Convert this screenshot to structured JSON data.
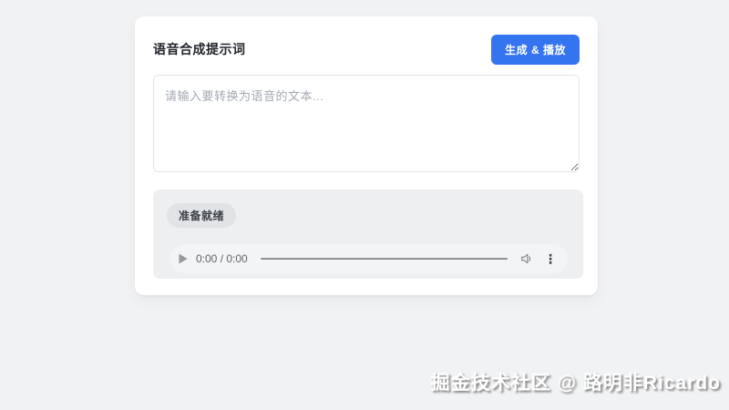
{
  "window": {
    "background_color": "#f1f2f4"
  },
  "card": {
    "title": "语音合成提示词",
    "generate_button": {
      "label": "生成 & 播放",
      "color": "#3574f0"
    },
    "prompt_input": {
      "value": "",
      "placeholder": "请输入要转换为语音的文本..."
    },
    "result_panel": {
      "status_badge": "准备就绪",
      "audio_player": {
        "time_display": "0:00 / 0:00",
        "time_current": "0:00",
        "time_total": "0:00",
        "progress_percent": 0,
        "play_icon": "play-icon",
        "volume_icon": "volume-icon",
        "menu_icon_glyph": "⋮"
      }
    }
  },
  "watermark": {
    "text": "掘金技术社区 @ 路明非Ricardo"
  }
}
